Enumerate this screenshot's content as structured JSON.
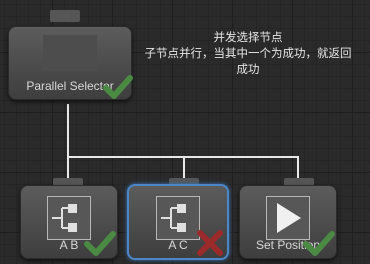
{
  "root": {
    "label": "Parallel Selector",
    "status": "success",
    "comment_lines": [
      "并发选择节点",
      "子节点并行，当其中一个为成功，就返回",
      "成功"
    ]
  },
  "children": [
    {
      "label": "A  B",
      "icon": "sequence-icon",
      "status": "success"
    },
    {
      "label": "A  C",
      "icon": "sequence-icon",
      "status": "failure"
    },
    {
      "label": "Set Position",
      "icon": "play-icon",
      "status": "success"
    }
  ],
  "colors": {
    "success": "#4a8a43",
    "failure": "#9b2a2a",
    "selected_border": "#4d86c8",
    "wire": "#e8e8e8"
  }
}
